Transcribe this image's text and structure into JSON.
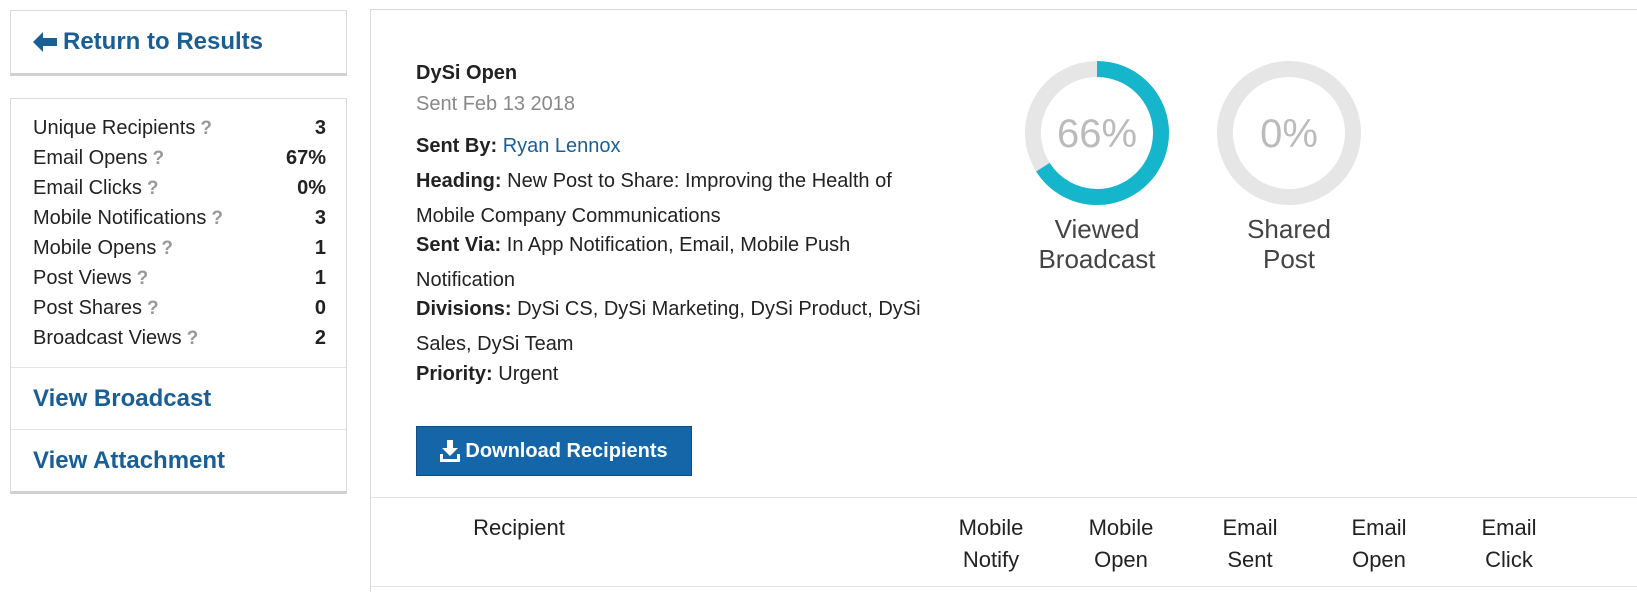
{
  "sidebar": {
    "return_label": "Return to Results",
    "stats": [
      {
        "label": "Unique Recipients",
        "value": "3"
      },
      {
        "label": "Email Opens",
        "value": "67%"
      },
      {
        "label": "Email Clicks",
        "value": "0%"
      },
      {
        "label": "Mobile Notifications",
        "value": "3"
      },
      {
        "label": "Mobile Opens",
        "value": "1"
      },
      {
        "label": "Post Views",
        "value": "1"
      },
      {
        "label": "Post Shares",
        "value": "0"
      },
      {
        "label": "Broadcast Views",
        "value": "2"
      }
    ],
    "help_glyph": "?",
    "view_broadcast": "View Broadcast",
    "view_attachment": "View Attachment"
  },
  "broadcast": {
    "title": "DySi Open",
    "sent_date": "Sent Feb 13 2018",
    "sent_by_label": "Sent By:",
    "sent_by": "Ryan Lennox",
    "heading_label": "Heading:",
    "heading_line1": "New Post to Share: Improving the Health of",
    "heading_line2": "Mobile Company Communications",
    "sent_via_label": "Sent Via:",
    "sent_via_line1": "In App Notification, Email, Mobile Push",
    "sent_via_line2": "Notification",
    "divisions_label": "Divisions:",
    "divisions_line1": "DySi CS, DySi Marketing, DySi Product, DySi",
    "divisions_line2": "Sales, DySi Team",
    "priority_label": "Priority:",
    "priority": "Urgent",
    "download_label": "Download Recipients"
  },
  "donuts": [
    {
      "percent_text": "66%",
      "fraction": 0.66,
      "label_line1": "Viewed",
      "label_line2": "Broadcast",
      "color": "#15b5cc"
    },
    {
      "percent_text": "0%",
      "fraction": 0,
      "label_line1": "Shared",
      "label_line2": "Post",
      "color": "#15b5cc"
    }
  ],
  "table": {
    "headers": [
      {
        "line1": "Recipient",
        "line2": ""
      },
      {
        "line1": "Mobile",
        "line2": "Notify"
      },
      {
        "line1": "Mobile",
        "line2": "Open"
      },
      {
        "line1": "Email",
        "line2": "Sent"
      },
      {
        "line1": "Email",
        "line2": "Open"
      },
      {
        "line1": "Email",
        "line2": "Click"
      }
    ]
  },
  "colors": {
    "link": "#1a5e96",
    "button": "#1566a8",
    "ring_track": "#e6e6e6"
  },
  "icons": {
    "return": "arrow-left-icon",
    "download": "download-icon",
    "help": "question-icon"
  }
}
